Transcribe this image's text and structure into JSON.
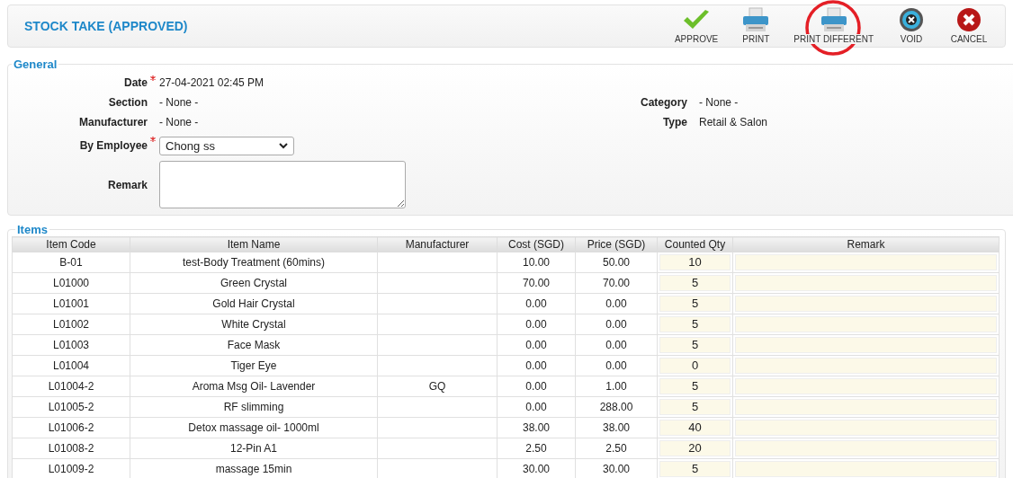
{
  "header": {
    "title": "STOCK TAKE (APPROVED)",
    "actions": [
      {
        "kind": "approve",
        "label": "APPROVE",
        "highlighted": false
      },
      {
        "kind": "print",
        "label": "PRINT",
        "highlighted": false
      },
      {
        "kind": "print",
        "label": "PRINT DIFFERENT",
        "highlighted": true
      },
      {
        "kind": "void",
        "label": "VOID",
        "highlighted": false
      },
      {
        "kind": "cancel",
        "label": "CANCEL",
        "highlighted": false
      }
    ]
  },
  "general": {
    "legend": "General",
    "left": [
      {
        "kind": "text",
        "label": "Date",
        "required": true,
        "value": "27-04-2021 02:45 PM"
      },
      {
        "kind": "text",
        "label": "Section",
        "required": false,
        "value": "- None -"
      },
      {
        "kind": "text",
        "label": "Manufacturer",
        "required": false,
        "value": "- None -"
      },
      {
        "kind": "select",
        "label": "By Employee",
        "required": true,
        "value": "Chong ss"
      },
      {
        "kind": "textarea",
        "label": "Remark",
        "required": false
      }
    ],
    "right": [
      {
        "label": "Category",
        "value": "- None -"
      },
      {
        "label": "Type",
        "value": "Retail & Salon"
      }
    ]
  },
  "items": {
    "legend": "Items",
    "columns": [
      "Item Code",
      "Item Name",
      "Manufacturer",
      "Cost (SGD)",
      "Price (SGD)",
      "Counted Qty",
      "Remark"
    ],
    "rows": [
      {
        "code": "B-01",
        "name": "test-Body Treatment (60mins)",
        "manufacturer": "",
        "cost": "10.00",
        "price": "50.00",
        "qty": "10"
      },
      {
        "code": "L01000",
        "name": "Green Crystal",
        "manufacturer": "",
        "cost": "70.00",
        "price": "70.00",
        "qty": "5"
      },
      {
        "code": "L01001",
        "name": "Gold Hair Crystal",
        "manufacturer": "",
        "cost": "0.00",
        "price": "0.00",
        "qty": "5"
      },
      {
        "code": "L01002",
        "name": "White Crystal",
        "manufacturer": "",
        "cost": "0.00",
        "price": "0.00",
        "qty": "5"
      },
      {
        "code": "L01003",
        "name": "Face Mask",
        "manufacturer": "",
        "cost": "0.00",
        "price": "0.00",
        "qty": "5"
      },
      {
        "code": "L01004",
        "name": "Tiger Eye",
        "manufacturer": "",
        "cost": "0.00",
        "price": "0.00",
        "qty": "0"
      },
      {
        "code": "L01004-2",
        "name": "Aroma Msg Oil- Lavender",
        "manufacturer": "GQ",
        "cost": "0.00",
        "price": "1.00",
        "qty": "5"
      },
      {
        "code": "L01005-2",
        "name": "RF slimming",
        "manufacturer": "",
        "cost": "0.00",
        "price": "288.00",
        "qty": "5"
      },
      {
        "code": "L01006-2",
        "name": "Detox massage oil- 1000ml",
        "manufacturer": "",
        "cost": "38.00",
        "price": "38.00",
        "qty": "40"
      },
      {
        "code": "L01008-2",
        "name": "12-Pin A1",
        "manufacturer": "",
        "cost": "2.50",
        "price": "2.50",
        "qty": "20"
      },
      {
        "code": "L01009-2",
        "name": "massage 15min",
        "manufacturer": "",
        "cost": "30.00",
        "price": "30.00",
        "qty": "5"
      }
    ]
  }
}
